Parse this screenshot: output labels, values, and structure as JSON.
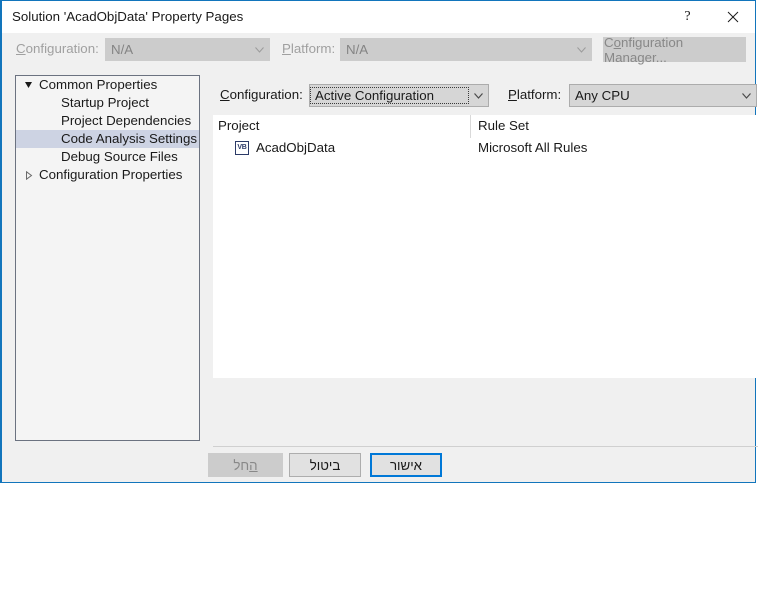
{
  "window": {
    "title": "Solution 'AcadObjData' Property Pages",
    "help_label": "?",
    "close_label": "✕"
  },
  "top_strip": {
    "configuration_label": "Configuration:",
    "configuration_label_accel": "C",
    "configuration_value": "N/A",
    "platform_label": "Platform:",
    "platform_label_accel": "P",
    "platform_value": "N/A",
    "configuration_manager_label": "Configuration Manager...",
    "configuration_manager_accel": "o"
  },
  "tree": {
    "nodes": [
      {
        "label": "Common Properties",
        "level": 0,
        "glyph": "triangle-down-filled",
        "selected": false
      },
      {
        "label": "Startup Project",
        "level": 1,
        "glyph": "none",
        "selected": false
      },
      {
        "label": "Project Dependencies",
        "level": 1,
        "glyph": "none",
        "selected": false
      },
      {
        "label": "Code Analysis Settings",
        "level": 1,
        "glyph": "none",
        "selected": true
      },
      {
        "label": "Debug Source Files",
        "level": 1,
        "glyph": "none",
        "selected": false
      },
      {
        "label": "Configuration Properties",
        "level": 0,
        "glyph": "triangle-right-hollow",
        "selected": false
      }
    ]
  },
  "panel": {
    "configuration_label": "Configuration:",
    "configuration_label_accel": "C",
    "configuration_value": "Active Configuration",
    "platform_label": "Platform:",
    "platform_label_accel": "P",
    "platform_value": "Any CPU",
    "grid": {
      "columns": [
        "Project",
        "Rule Set"
      ],
      "rows": [
        {
          "icon": "vb-project-icon",
          "icon_text": "VB",
          "project": "AcadObjData",
          "rule_set": "Microsoft All Rules"
        }
      ]
    }
  },
  "footer": {
    "apply_label": "החל",
    "apply_accel": "ה",
    "cancel_label": "ביטול",
    "ok_label": "אישור"
  },
  "colors": {
    "accent": "#1275bc",
    "focus_border": "#0078d7",
    "selection": "#cdd3e3",
    "dialog_bg": "#f0f0f0",
    "panel_bg": "#f4f4f4"
  }
}
